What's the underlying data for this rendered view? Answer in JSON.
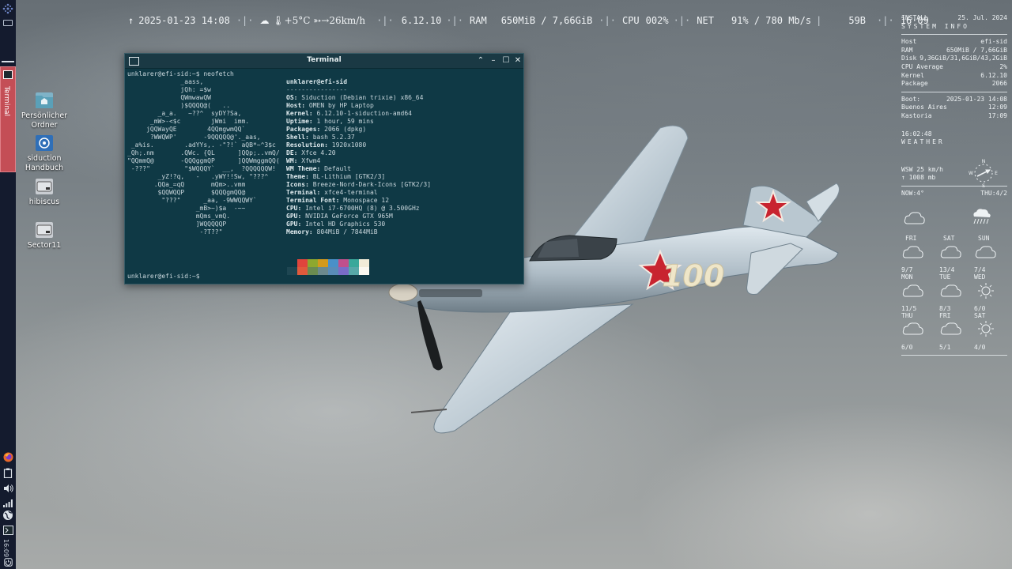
{
  "colors": {
    "panel": "#141b2e",
    "terminal_bg": "#0f3945",
    "task_active": "#c44e56"
  },
  "left_panel": {
    "task_button_label": "Terminal",
    "clock": "16:09",
    "tray_icons": [
      "firefox-icon",
      "clipboard-icon",
      "volume-icon",
      "network-icon",
      "globe-icon",
      "terminal-icon",
      "power-icon"
    ]
  },
  "topbar": {
    "uptime_arrow": "↑",
    "datetime": "2025-01-23 14:08",
    "weather": "☁ 🌡+5°C ➳→26km/h",
    "kernel": "6.12.10",
    "ram_label": "RAM",
    "ram_value": "650MiB / 7,66GiB",
    "cpu_label": "CPU",
    "cpu_value": "002%",
    "net_label": "NET",
    "net_value": "91% / 780 Mb/s",
    "extra": "59B",
    "time": "16·09"
  },
  "desktop_icons": [
    {
      "label": "Persönlicher Ordner",
      "icon": "home-folder-icon"
    },
    {
      "label": "siduction Handbuch",
      "icon": "handbook-icon"
    },
    {
      "label": "hibiscus",
      "icon": "drive-icon"
    },
    {
      "label": "Sector11",
      "icon": "drive-icon"
    }
  ],
  "terminal": {
    "title": "Terminal",
    "prompt": "unklarer@efi-sid:~$",
    "command": "neofetch",
    "prompt_end": "unklarer@efi-sid:~$",
    "ascii_art": "              _aass,\n              jQh: =$w\n              QWmwawQW\n              )$QQQQ@(   ..\n        _a_a.   ~??^  syDY?Sa,\n      _mW>-<$c        jWmi  imm.\n     jQQWayQE        4QQmgwmQQ`\n      ?WWQWP'       -9QQQQQ@'._aas,\n _a%is.        .adYYs,. -\"?!` aQB*~^3$c\n_Qh;.nm       .QWc. {QL      ]QQp;..vmQ/\n\"QQmmQ@       -QQQggmQP      ]QQWmggmQQ(\n -???\"         \"$WQQQY`  __,  ?QQQQQQW!\n        _yZ!?q,   -   .yWY!!Sw, \"???^\n       .QQa_=qQ       mQm>..vmm\n        $QQWQQP       $QQQgmQQ@\n         \"???\"      _aa, -9WWQQWY`\n                  _mB>~)$a  -~~\n                  mQms_vmQ.\n                  ]WQQQQQP\n                   -?T??\"",
    "user_host": "unklarer@efi-sid",
    "rule": "----------------",
    "info": [
      {
        "k": "OS:",
        "v": " Siduction (Debian trixie) x86_64"
      },
      {
        "k": "Host:",
        "v": " OMEN by HP Laptop"
      },
      {
        "k": "Kernel:",
        "v": " 6.12.10-1-siduction-amd64"
      },
      {
        "k": "Uptime:",
        "v": " 1 hour, 59 mins"
      },
      {
        "k": "Packages:",
        "v": " 2066 (dpkg)"
      },
      {
        "k": "Shell:",
        "v": " bash 5.2.37"
      },
      {
        "k": "Resolution:",
        "v": " 1920x1080"
      },
      {
        "k": "DE:",
        "v": " Xfce 4.20"
      },
      {
        "k": "WM:",
        "v": " Xfwm4"
      },
      {
        "k": "WM Theme:",
        "v": " Default"
      },
      {
        "k": "Theme:",
        "v": " BL-Lithium [GTK2/3]"
      },
      {
        "k": "Icons:",
        "v": " Breeze-Nord-Dark-Icons [GTK2/3]"
      },
      {
        "k": "Terminal:",
        "v": " xfce4-terminal"
      },
      {
        "k": "Terminal Font:",
        "v": " Monospace 12"
      },
      {
        "k": "CPU:",
        "v": " Intel i7-6700HQ (8) @ 3.500GHz"
      },
      {
        "k": "GPU:",
        "v": " NVIDIA GeForce GTX 965M"
      },
      {
        "k": "GPU:",
        "v": " Intel HD Graphics 530"
      },
      {
        "k": "Memory:",
        "v": " 804MiB / 7844MiB"
      }
    ],
    "palette": [
      [
        "#0f3945",
        "#1e4652"
      ],
      [
        "#e0453c",
        "#e05a3c"
      ],
      [
        "#8ea82e",
        "#6b8c50"
      ],
      [
        "#d49a1c",
        "#6c8a8e"
      ],
      [
        "#4a90c8",
        "#5a8cb8"
      ],
      [
        "#c0508c",
        "#7a6cc8"
      ],
      [
        "#3aa89a",
        "#58a8a8"
      ],
      [
        "#f2ecd8",
        "#fbf8f0"
      ]
    ]
  },
  "conky": {
    "install_label": "INSTALL",
    "install_date": "25. Jul. 2024",
    "sysinfo_head": "SYSTEM INFO",
    "host_label": "Host",
    "host_value": "efi-sid",
    "ram_label": "RAM",
    "ram_value": "650MiB / 7,66GiB",
    "disk_label": "Disk",
    "disk_value": "9,36GiB/31,6GiB/43,2GiB",
    "cpu_label": "CPU Average",
    "cpu_value": "2%",
    "kernel_label": "Kernel",
    "kernel_value": "6.12.10",
    "package_label": "Package",
    "package_value": "2066",
    "boot_label": "Boot:",
    "boot_value": "2025-01-23 14:08",
    "city1": "Buenos Aires",
    "city1_time": "12:09",
    "city2": "Kastoria",
    "city2_time": "17:09",
    "clock": "16:02:48",
    "weather_head": "WEATHER",
    "wind": "WSW 25 km/h",
    "pressure": "↑ 1008 mb",
    "now": "NOW:4°",
    "now_right": "THU:4/2",
    "forecast_row1": [
      "FRI",
      "SAT",
      "SUN"
    ],
    "forecast_temps1": [
      "9/7",
      "13/4",
      "7/4"
    ],
    "forecast_row2": [
      "MON",
      "TUE",
      "WED"
    ],
    "forecast_temps2": [
      "11/5",
      "8/3",
      "6/0"
    ],
    "forecast_row3": [
      "THU",
      "FRI",
      "SAT"
    ],
    "forecast_temps3": [
      "6/0",
      "5/1",
      "4/0"
    ]
  }
}
